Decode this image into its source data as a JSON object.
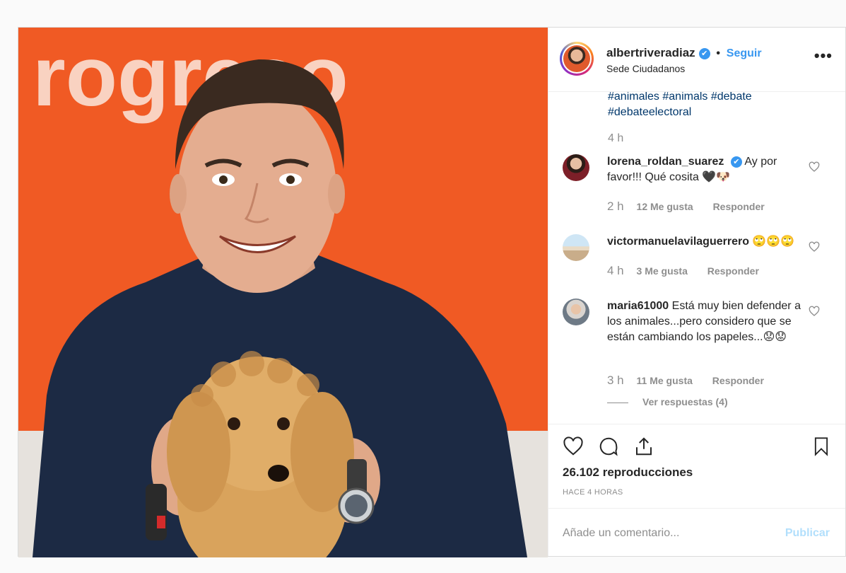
{
  "post": {
    "username": "albertriveradiaz",
    "verified_mark": "✔",
    "separator": "•",
    "follow_label": "Seguir",
    "location": "Sede Ciudadanos",
    "more_label": "•••",
    "media_background_text": "rogreso"
  },
  "caption": {
    "tags_line1": "#animales #animals #debate",
    "tags_line2": "#debateelectoral",
    "time": "4 h"
  },
  "comments": [
    {
      "username": "lorena_roldan_suarez",
      "verified": true,
      "text": "Ay por favor!!! Qué cosita 🖤🐶",
      "time": "2 h",
      "likes": "12 Me gusta",
      "reply": "Responder"
    },
    {
      "username": "victormanuelavilaguerrero",
      "verified": false,
      "text": "🙄🙄🙄",
      "time": "4 h",
      "likes": "3 Me gusta",
      "reply": "Responder"
    },
    {
      "username": "maria61000",
      "verified": false,
      "text": "Está muy bien defender a los animales...pero considero que se están cambiando los papeles...😟😟",
      "time": "3 h",
      "likes": "11 Me gusta",
      "reply": "Responder"
    }
  ],
  "view_replies": "Ver respuestas (4)",
  "stats": {
    "views": "26.102 reproducciones",
    "posted_ago": "HACE 4 HORAS"
  },
  "add_comment": {
    "placeholder": "Añade un comentario...",
    "publish_label": "Publicar"
  },
  "colors": {
    "accent": "#3897f0",
    "media_orange": "#f05a24",
    "sweater": "#1c2a44"
  }
}
